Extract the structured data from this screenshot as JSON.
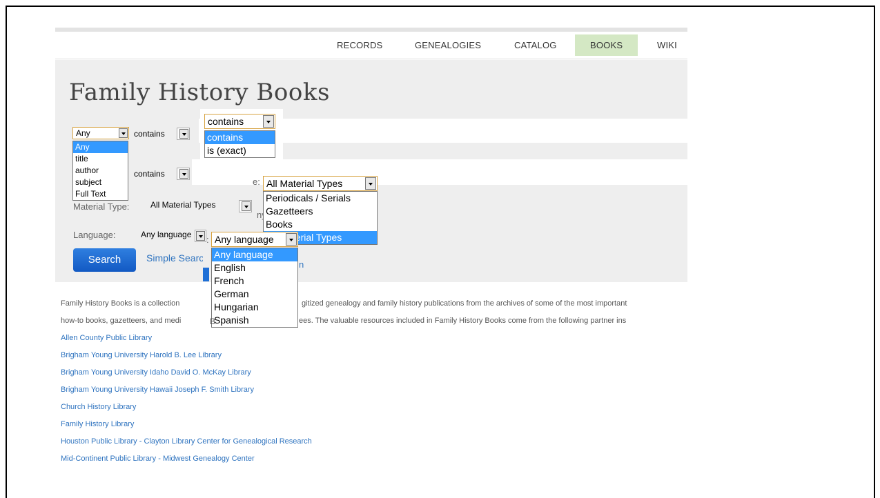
{
  "nav": {
    "items": [
      {
        "label": "RECORDS"
      },
      {
        "label": "GENEALOGIES"
      },
      {
        "label": "CATALOG"
      },
      {
        "label": "BOOKS",
        "active": true
      },
      {
        "label": "WIKI"
      }
    ]
  },
  "page_title": "Family History Books",
  "form": {
    "field_select_value": "Any",
    "field_options": [
      "Any",
      "title",
      "author",
      "subject",
      "Full Text"
    ],
    "contains_label_1": "contains",
    "contains_label_2": "contains",
    "operator_select_value": "contains",
    "operator_options": [
      "contains",
      "is (exact)"
    ],
    "material_type_label": "Material Type:",
    "material_type_value": "All Material Types",
    "material_popup_value": "All Material Types",
    "material_options": [
      "Periodicals / Serials",
      "Gazetteers",
      "Books",
      "All Material Types"
    ],
    "material_label_fragment": "e:",
    "material_hint_fragment": "ny",
    "language_label": "Language:",
    "language_value": "Any language",
    "language_popup_value": "Any language",
    "language_options": [
      "Any language",
      "English",
      "French",
      "German",
      "Hungarian",
      "Spanish"
    ],
    "language_label_fragment": ":",
    "search_button": "Search",
    "simple_search_link": "Simple Search",
    "ghost_text": "n"
  },
  "description": {
    "line1_left": "Family History Books is a collection",
    "line1_right": "gitized genealogy and family history publications from the archives of some of the most important",
    "line2_left": "how-to books, gazetteers, and medi",
    "line2_fragment": "B",
    "line2_right": "ees. The valuable resources included in Family History Books come from the following partner ins"
  },
  "libraries": [
    "Allen County Public Library",
    "Brigham Young University Harold B. Lee Library",
    "Brigham Young University Idaho David O. McKay Library",
    "Brigham Young University Hawaii Joseph F. Smith Library",
    "Church History Library",
    "Family History Library",
    "Houston Public Library - Clayton Library Center for Genealogical Research",
    "Mid-Continent Public Library - Midwest Genealogy Center"
  ],
  "colors": {
    "nav_active_bg": "#d4e8c4",
    "panel_bg": "#eeeeee",
    "link": "#2e73bf",
    "button": "#1e6fd6",
    "highlight": "#3399ff"
  }
}
